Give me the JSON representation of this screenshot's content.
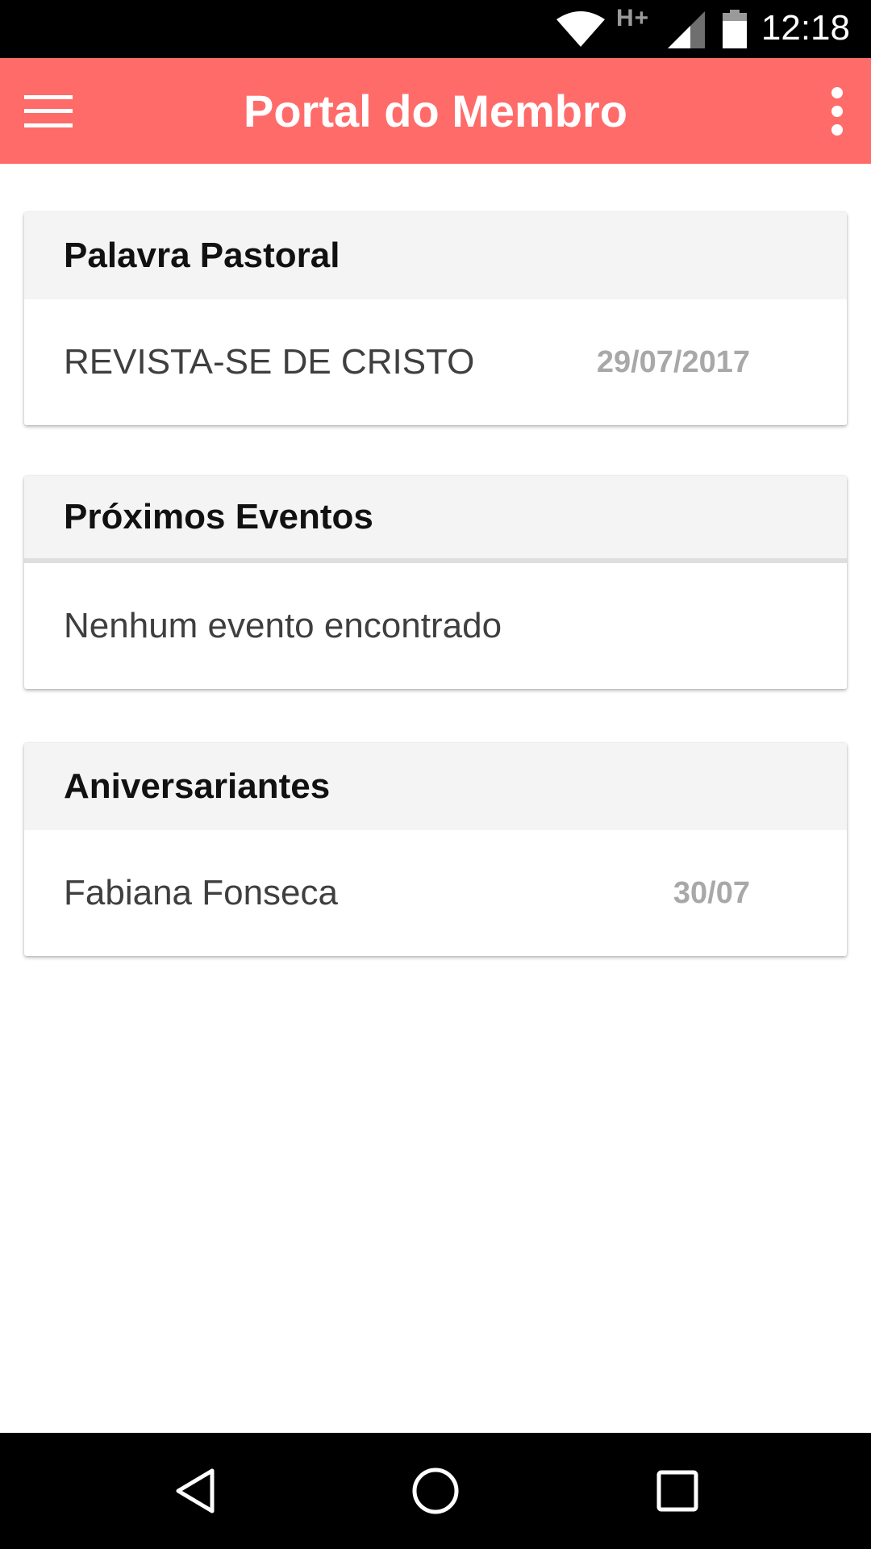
{
  "status_bar": {
    "network_type": "H+",
    "time": "12:18",
    "icons": [
      "wifi-icon",
      "signal-icon",
      "battery-icon"
    ]
  },
  "app_bar": {
    "title": "Portal do Membro",
    "background_color": "#ff6b69",
    "left_icon": "menu-icon",
    "right_icon": "more-vert-icon"
  },
  "cards": {
    "pastoral": {
      "title": "Palavra Pastoral",
      "items": [
        {
          "text": "REVISTA-SE DE CRISTO",
          "date": "29/07/2017"
        }
      ]
    },
    "events": {
      "title": "Próximos Eventos",
      "empty_message": "Nenhum evento encontrado"
    },
    "birthdays": {
      "title": "Aniversariantes",
      "items": [
        {
          "text": "Fabiana Fonseca",
          "date": "30/07"
        }
      ]
    }
  },
  "nav_bar": {
    "icons": [
      "back-icon",
      "home-icon",
      "recents-icon"
    ]
  }
}
